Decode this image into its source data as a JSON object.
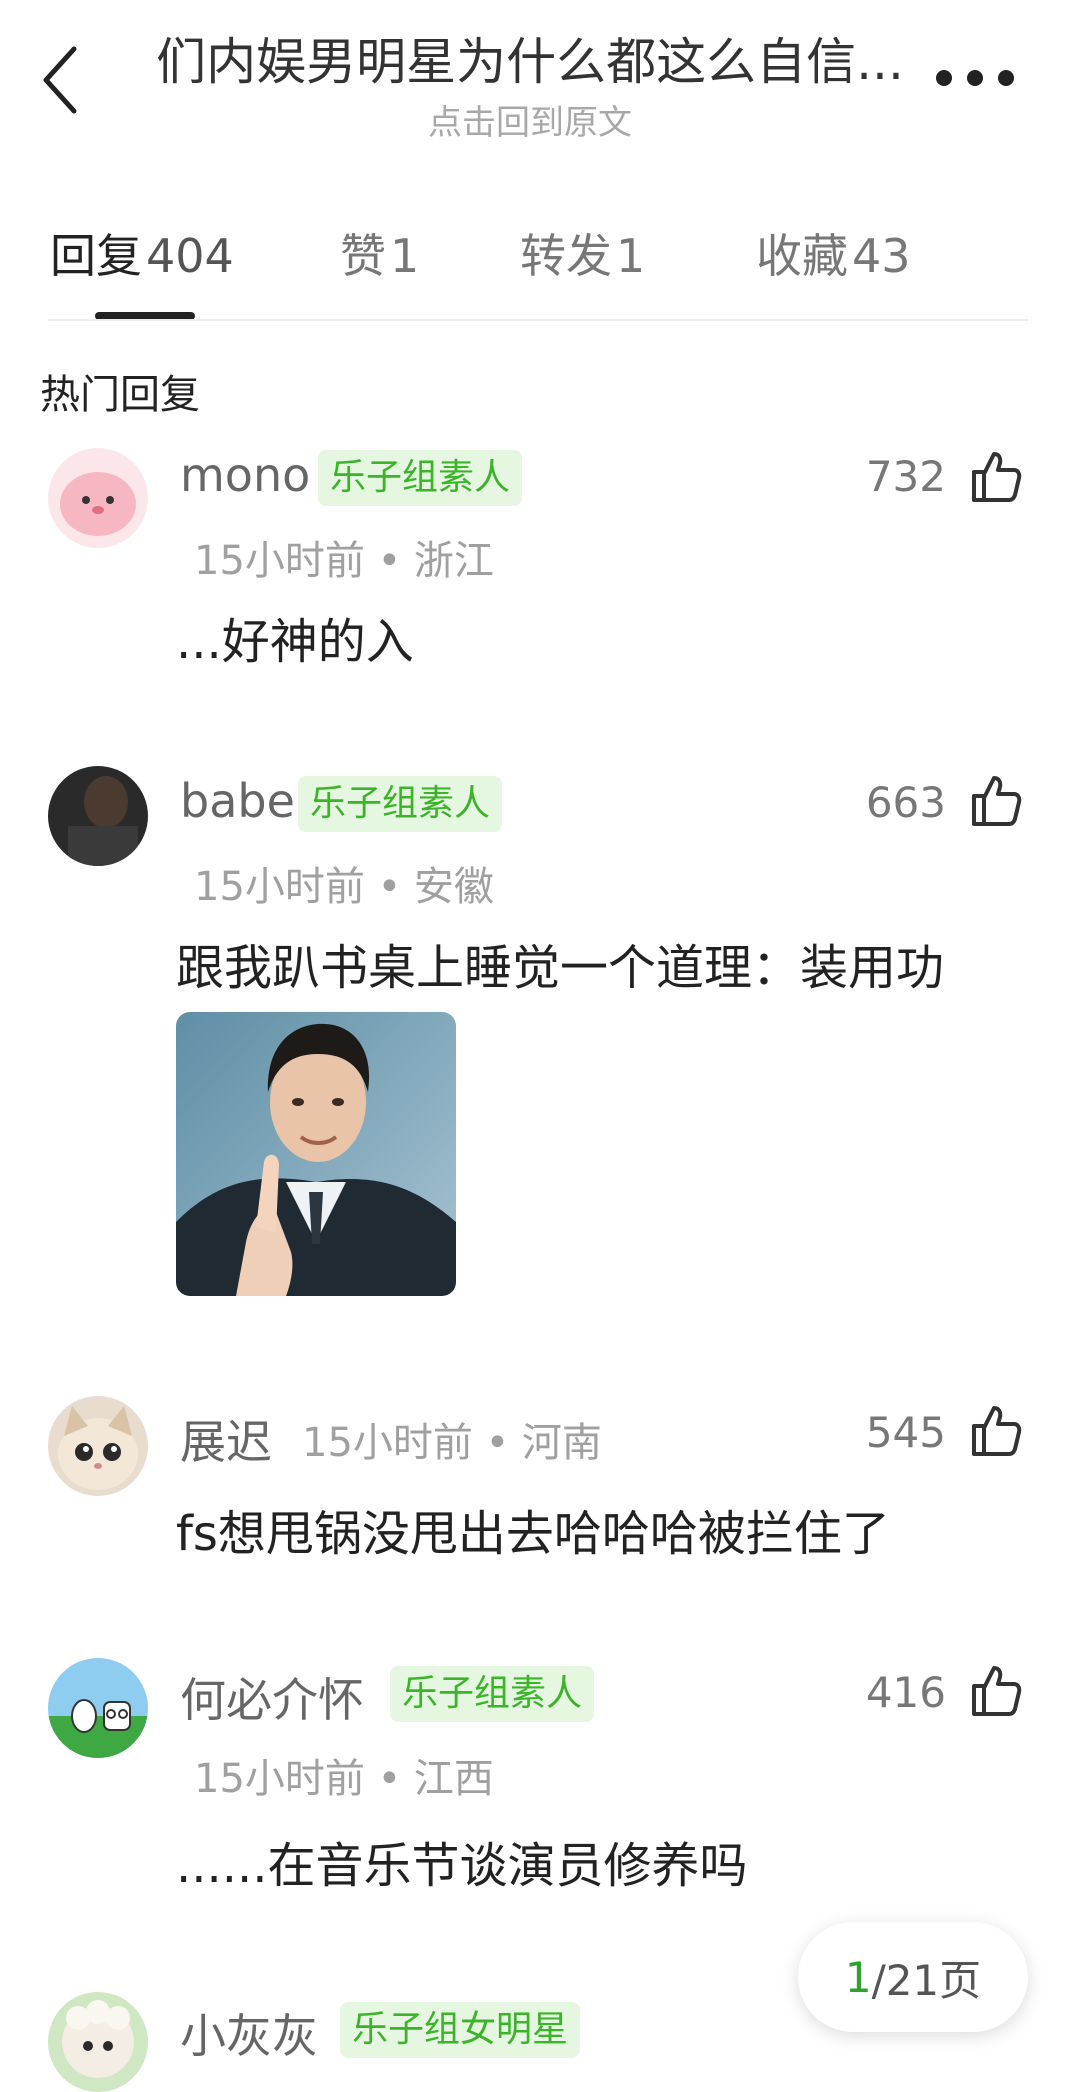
{
  "header": {
    "title": "们内娱男明星为什么都这么自信...",
    "subtitle": "点击回到原文"
  },
  "tabs": [
    {
      "label": "回复",
      "count": "404"
    },
    {
      "label": "赞",
      "count": "1"
    },
    {
      "label": "转发",
      "count": "1"
    },
    {
      "label": "收藏",
      "count": "43"
    }
  ],
  "section_title": "热门回复",
  "comments": [
    {
      "username": "mono",
      "badge": "乐子组素人",
      "time_location": "15小时前 • 浙江",
      "likes": "732",
      "content": "...好神的入"
    },
    {
      "username": "babe",
      "badge": "乐子组素人",
      "time_location": "15小时前 • 安徽",
      "likes": "663",
      "content": "跟我趴书桌上睡觉一个道理：装用功"
    },
    {
      "username": "展迟",
      "badge": "",
      "time_location": "15小时前 • 河南",
      "likes": "545",
      "content": "fs想甩锅没甩出去哈哈哈被拦住了"
    },
    {
      "username": "何必介怀",
      "badge": "乐子组素人",
      "time_location": "15小时前 • 江西",
      "likes": "416",
      "content": "......在音乐节谈演员修养吗"
    },
    {
      "username": "小灰灰",
      "badge": "乐子组女明星",
      "time_location": "",
      "likes": "",
      "content": ""
    }
  ],
  "pager": {
    "current": "1",
    "total_suffix": "/21页"
  },
  "colors": {
    "badge_text": "#3bb42a",
    "badge_bg": "#e6f7e1",
    "pager_current": "#2aa32a"
  }
}
